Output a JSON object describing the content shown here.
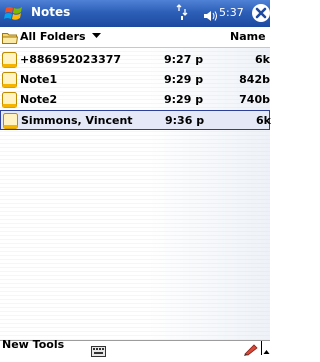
{
  "titlebar": {
    "app_title": "Notes",
    "time": "5:37",
    "icons": [
      "windows-start-icon",
      "connectivity-icon",
      "speaker-icon",
      "close-icon"
    ],
    "accent_color": "#2d5fb8"
  },
  "header": {
    "folder_label": "All Folders",
    "sort_label": "Name"
  },
  "notes": [
    {
      "name": "+886952023377",
      "time": "9:27 p",
      "size": "6k"
    },
    {
      "name": "Note1",
      "time": "9:29 p",
      "size": "842b"
    },
    {
      "name": "Note2",
      "time": "9:29 p",
      "size": "740b"
    },
    {
      "name": "Simmons, Vincent",
      "time": "9:36 p",
      "size": "6k",
      "selected": true
    }
  ],
  "menubar": {
    "text": "New Tools"
  }
}
